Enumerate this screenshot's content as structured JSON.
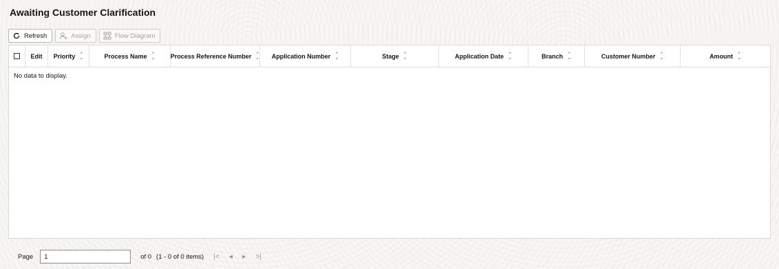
{
  "page": {
    "title": "Awaiting Customer Clarification"
  },
  "toolbar": {
    "refresh_label": "Refresh",
    "assign_label": "Assign",
    "flow_diagram_label": "Flow Diagram"
  },
  "table": {
    "columns": [
      {
        "label": "Edit",
        "sortable": false
      },
      {
        "label": "Priority",
        "sortable": true
      },
      {
        "label": "Process Name",
        "sortable": true
      },
      {
        "label": "Process Reference Number",
        "sortable": true
      },
      {
        "label": "Application Number",
        "sortable": true
      },
      {
        "label": "Stage",
        "sortable": true
      },
      {
        "label": "Application Date",
        "sortable": true
      },
      {
        "label": "Branch",
        "sortable": true
      },
      {
        "label": "Customer Number",
        "sortable": true
      },
      {
        "label": "Amount",
        "sortable": true
      }
    ],
    "rows": [],
    "empty_text": "No data to display."
  },
  "pagination": {
    "page_label": "Page",
    "page_value": "1",
    "of_text": "of 0",
    "items_text": "(1 - 0 of 0 items)",
    "first_icon": "first-page-icon",
    "prev_icon": "previous-page-icon",
    "next_icon": "next-page-icon",
    "last_icon": "last-page-icon"
  }
}
